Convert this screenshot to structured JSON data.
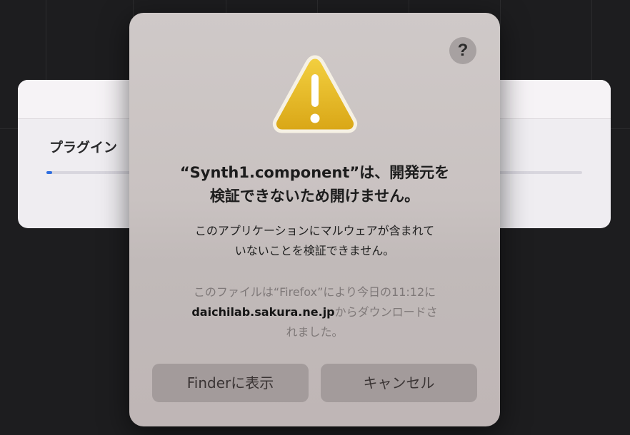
{
  "background_window": {
    "label": "プラグイン",
    "progress": 0.01,
    "accent_color": "#2f6fe0"
  },
  "alert": {
    "help_label": "?",
    "icon": "warning-triangle-icon",
    "title_lines": [
      "“Synth1.component”は、開発元を",
      "検証できないため開けません。"
    ],
    "message_lines": [
      "このアプリケーションにマルウェアが含まれて",
      "いないことを検証できません。"
    ],
    "info": {
      "line1": "このファイルは“Firefox”により今日の11:12に",
      "domain": "daichilab.sakura.ne.jp",
      "line2_suffix": "からダウンロードさ",
      "line3": "れました。"
    },
    "buttons": {
      "finder": "Finderに表示",
      "cancel": "キャンセル"
    }
  }
}
